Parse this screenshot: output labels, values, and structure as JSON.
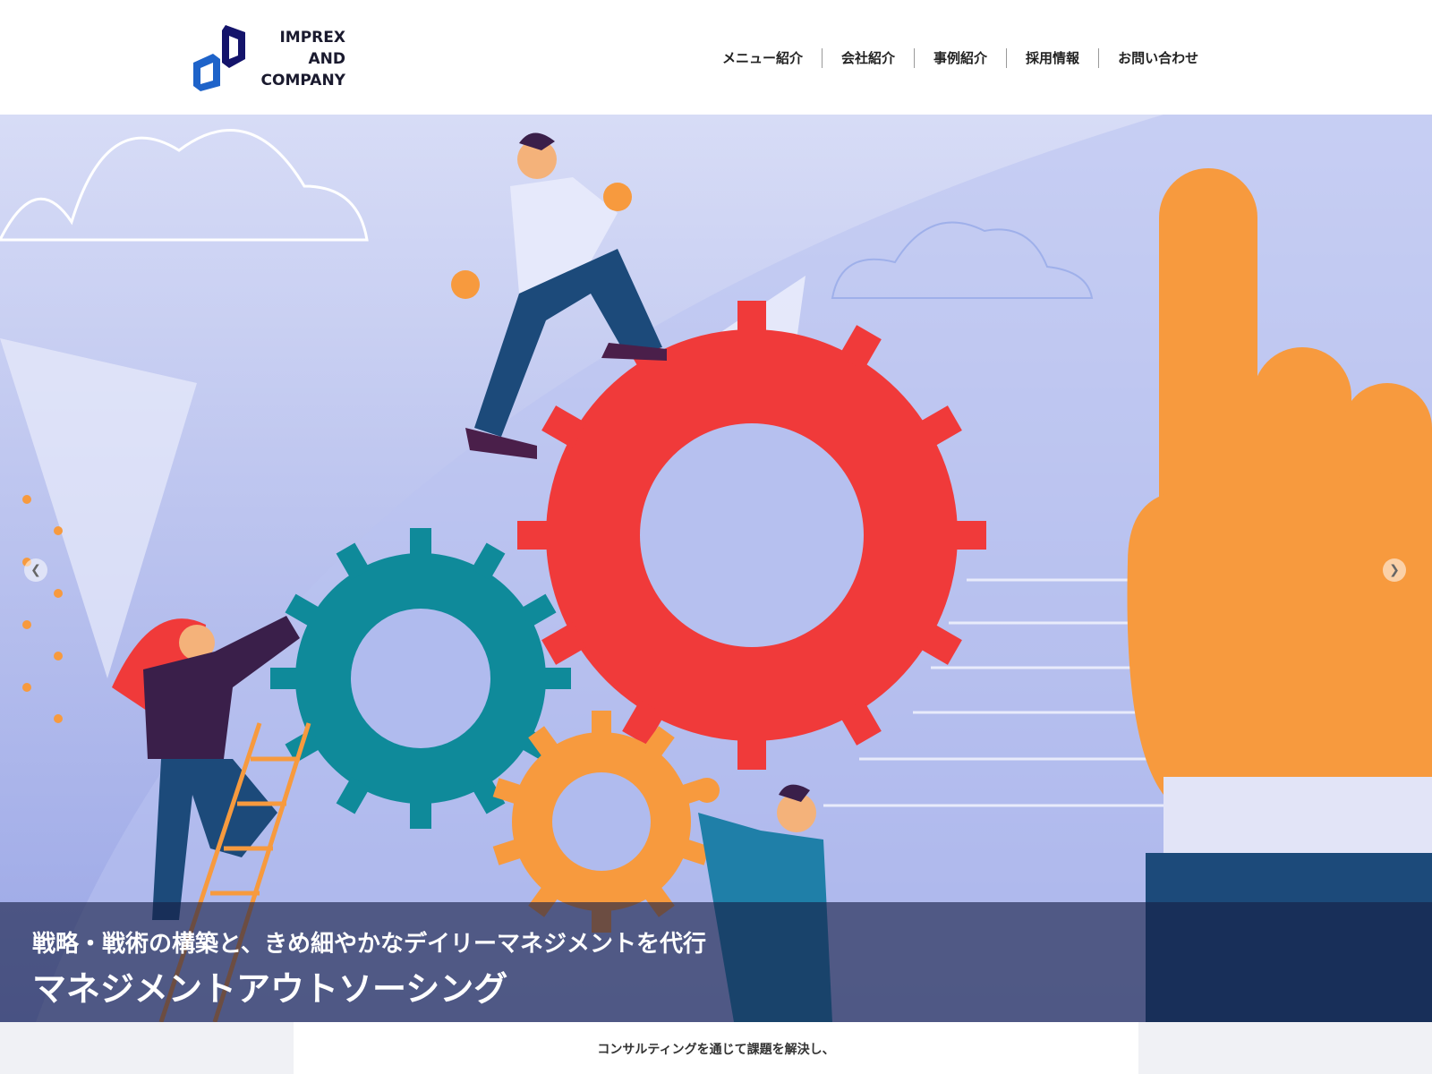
{
  "logo": {
    "line1": "IMPREX",
    "line2": "AND",
    "line3": "COMPANY",
    "mark_color": "#1e63c9",
    "mark_dark": "#14146b"
  },
  "nav": {
    "items": [
      {
        "label": "メニュー紹介"
      },
      {
        "label": "会社紹介"
      },
      {
        "label": "事例紹介"
      },
      {
        "label": "採用情報"
      },
      {
        "label": "お問い合わせ"
      }
    ]
  },
  "hero": {
    "subtitle": "戦略・戦術の構築と、きめ細やかなデイリーマネジメントを代行",
    "title": "マネジメントアウトソーシング",
    "prev_icon": "chevron-left-icon",
    "next_icon": "chevron-right-icon",
    "colors": {
      "background": "#c3c9f0",
      "red_gear": "#f03a3a",
      "teal_gear": "#0f8a9a",
      "orange": "#f79a3e",
      "navy": "#1c4a7a"
    }
  },
  "content": {
    "lead": "コンサルティングを通じて課題を解決し、"
  }
}
